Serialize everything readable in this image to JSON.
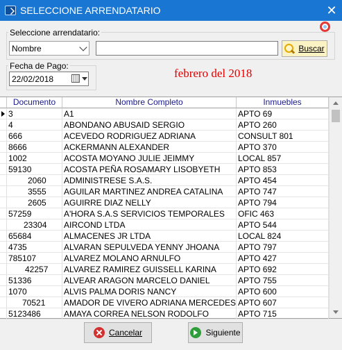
{
  "window": {
    "title": "SELECCIONE ARRENDATARIO",
    "close_glyph": "✕"
  },
  "search": {
    "group_label": "Seleccione arrendatario:",
    "field_selected": "Nombre",
    "input_value": "",
    "button_label": "Buscar"
  },
  "payment": {
    "group_label": "Fecha de Pago:",
    "date_value": "22/02/2018"
  },
  "period_text": "febrero del 2018",
  "table": {
    "columns": [
      "Documento",
      "Nombre Completo",
      "Inmuebles"
    ],
    "rows": [
      [
        "3",
        "A1",
        "APTO 69"
      ],
      [
        "4",
        "ABONDANO ABUSAID SERGIO",
        "APTO 260"
      ],
      [
        "666",
        "ACEVEDO RODRIGUEZ ADRIANA",
        "CONSULT 801"
      ],
      [
        "8666",
        "ACKERMANN  ALEXANDER",
        "APTO 370"
      ],
      [
        "1002",
        "ACOSTA MOYANO JULIE JEIMMY",
        "LOCAL 857"
      ],
      [
        "59130",
        "ACOSTA PEÑA ROSAMARY LISOBYETH",
        "APTO 853"
      ],
      [
        "2060",
        "ADMINISTRESE S.A.S.",
        "APTO 454"
      ],
      [
        "3555",
        "AGUILAR MARTINEZ ANDREA CATALINA",
        "APTO 747"
      ],
      [
        "2605",
        "AGUIRRE DIAZ NELLY",
        "APTO 794"
      ],
      [
        "57259",
        "A'HORA S.A.S SERVICIOS TEMPORALES",
        "OFIC 463"
      ],
      [
        "23304",
        "AIRCOND LTDA",
        "APTO 544"
      ],
      [
        "65684",
        "ALMACENES JR LTDA",
        "LOCAL 824"
      ],
      [
        "4735",
        "ALVARAN SEPULVEDA YENNY JHOANA",
        "APTO 797"
      ],
      [
        "785107",
        "ALVAREZ MOLANO ARNULFO",
        "APTO 427"
      ],
      [
        "42257",
        "ALVAREZ RAMIREZ GUISSELL KARINA",
        "APTO 692"
      ],
      [
        "51336",
        "ALVEAR ARAGON MARCELO DANIEL",
        "APTO 755"
      ],
      [
        "1070",
        "ALVIS PALMA DORIS NANCY",
        "APTO 600"
      ],
      [
        "70521",
        "AMADOR DE VIVERO ADRIANA MERCEDES",
        "APTO 607"
      ],
      [
        "5123486",
        "AMAYA CORREA NELSON RODOLFO",
        "APTO 715"
      ]
    ]
  },
  "footer": {
    "cancel_label": "Cancelar",
    "next_label": "Siguiente"
  },
  "colors": {
    "titlebar": "#1976d2",
    "period_text": "#e00000",
    "header_text": "#1a1a8a"
  }
}
